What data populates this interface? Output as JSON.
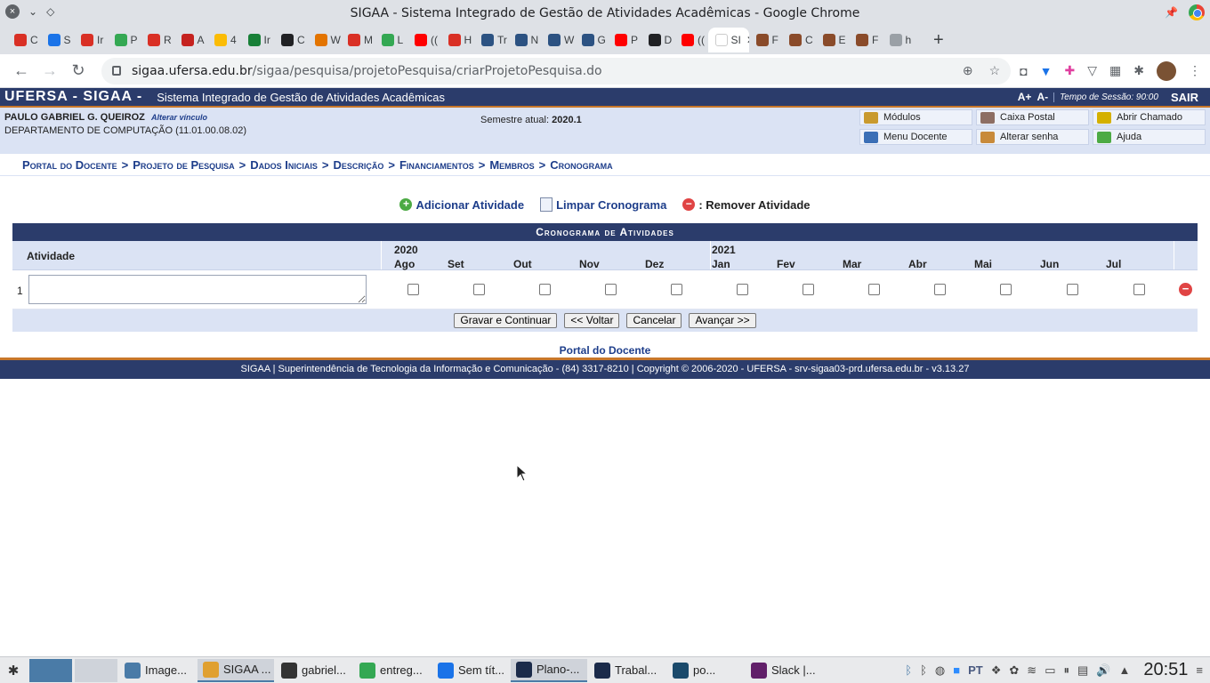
{
  "window": {
    "title": "SIGAA - Sistema Integrado de Gestão de Atividades Acadêmicas - Google Chrome"
  },
  "tabs": [
    {
      "label": "C",
      "color": "#d93025"
    },
    {
      "label": "S",
      "color": "#1a73e8"
    },
    {
      "label": "Ir",
      "color": "#d93025"
    },
    {
      "label": "P",
      "color": "#34a853"
    },
    {
      "label": "R",
      "color": "#d93025"
    },
    {
      "label": "A",
      "color": "#c5221f"
    },
    {
      "label": "4",
      "color": "#fbbc05"
    },
    {
      "label": "Ir",
      "color": "#188038"
    },
    {
      "label": "C",
      "color": "#202124"
    },
    {
      "label": "W",
      "color": "#e37400"
    },
    {
      "label": "M",
      "color": "#d93025"
    },
    {
      "label": "L",
      "color": "#34a853"
    },
    {
      "label": "((",
      "color": "#ff0000"
    },
    {
      "label": "H",
      "color": "#d93025"
    },
    {
      "label": "Tr",
      "color": "#2c5282"
    },
    {
      "label": "N",
      "color": "#2c5282"
    },
    {
      "label": "W",
      "color": "#2c5282"
    },
    {
      "label": "G",
      "color": "#2c5282"
    },
    {
      "label": "P",
      "color": "#ff0000"
    },
    {
      "label": "D",
      "color": "#202124"
    },
    {
      "label": "((",
      "color": "#ff0000"
    },
    {
      "label": "SI",
      "color": "#ffffff",
      "active": true
    },
    {
      "label": "F",
      "color": "#8a4b2a"
    },
    {
      "label": "C",
      "color": "#8a4b2a"
    },
    {
      "label": "E",
      "color": "#8a4b2a"
    },
    {
      "label": "F",
      "color": "#8a4b2a"
    },
    {
      "label": "h",
      "color": "#9aa0a6"
    }
  ],
  "omnibox": {
    "host": "sigaa.ufersa.edu.br",
    "path": "/sigaa/pesquisa/projetoPesquisa/criarProjetoPesquisa.do"
  },
  "sigaa": {
    "brand": "UFERSA - SIGAA -",
    "subtitle": "Sistema Integrado de Gestão de Atividades Acadêmicas",
    "font_increase": "A+",
    "font_decrease": "A-",
    "session": "Tempo de Sessão: 90:00",
    "logout": "SAIR"
  },
  "user": {
    "name": "PAULO GABRIEL G. QUEIROZ",
    "change_link": "Alterar vínculo",
    "department": "DEPARTAMENTO DE COMPUTAÇÃO (11.01.00.08.02)",
    "semester_label": "Semestre atual:",
    "semester_value": "2020.1"
  },
  "shortcuts": [
    {
      "label": "Módulos",
      "icon": "modules-icon",
      "color": "#c99a2e"
    },
    {
      "label": "Caixa Postal",
      "icon": "mailbox-icon",
      "color": "#8d6e63"
    },
    {
      "label": "Abrir Chamado",
      "icon": "ticket-icon",
      "color": "#d4b000"
    },
    {
      "label": "Menu Docente",
      "icon": "menu-icon",
      "color": "#3b6fb6"
    },
    {
      "label": "Alterar senha",
      "icon": "user-key-icon",
      "color": "#c88a3a"
    },
    {
      "label": "Ajuda",
      "icon": "help-icon",
      "color": "#4caa44"
    }
  ],
  "breadcrumb": [
    "Portal do Docente",
    "Projeto de Pesquisa",
    "Dados Iniciais",
    "Descrição",
    "Financiamentos",
    "Membros",
    "Cronograma"
  ],
  "breadcrumb_sep": ">",
  "actions": {
    "add": "Adicionar Atividade",
    "clear": "Limpar Cronograma",
    "remove": ": Remover Atividade"
  },
  "cronograma": {
    "caption": "Cronograma de Atividades",
    "activity_header": "Atividade",
    "years": [
      "2020",
      "2021"
    ],
    "months": [
      "Ago",
      "Set",
      "Out",
      "Nov",
      "Dez",
      "Jan",
      "Fev",
      "Mar",
      "Abr",
      "Mai",
      "Jun",
      "Jul"
    ],
    "rows": [
      {
        "index": "1",
        "activity": "",
        "checked": [
          false,
          false,
          false,
          false,
          false,
          false,
          false,
          false,
          false,
          false,
          false,
          false
        ]
      }
    ]
  },
  "buttons": {
    "save": "Gravar e Continuar",
    "back": "<< Voltar",
    "cancel": "Cancelar",
    "next": "Avançar >>"
  },
  "portal_link": "Portal do Docente",
  "footer": "SIGAA | Superintendência de Tecnologia da Informação e Comunicação - (84) 3317-8210 | Copyright © 2006-2020 - UFERSA - srv-sigaa03-prd.ufersa.edu.br - v3.13.27",
  "taskbar": {
    "tasks": [
      {
        "label": "Image...",
        "color": "#4a7ba7"
      },
      {
        "label": "SIGAA ...",
        "color": "#e0a030",
        "active": true
      },
      {
        "label": "gabriel...",
        "color": "#333333"
      },
      {
        "label": "entreg...",
        "color": "#34a853"
      },
      {
        "label": "Sem tít...",
        "color": "#1a73e8"
      },
      {
        "label": "Plano-...",
        "color": "#1b2b4a",
        "active": true
      },
      {
        "label": "Trabal...",
        "color": "#1b2b4a"
      },
      {
        "label": "po...",
        "color": "#1b4a6b"
      },
      {
        "label": "Slack |...",
        "color": "#611f69"
      }
    ],
    "lang": "PT",
    "clock": "20:51"
  }
}
